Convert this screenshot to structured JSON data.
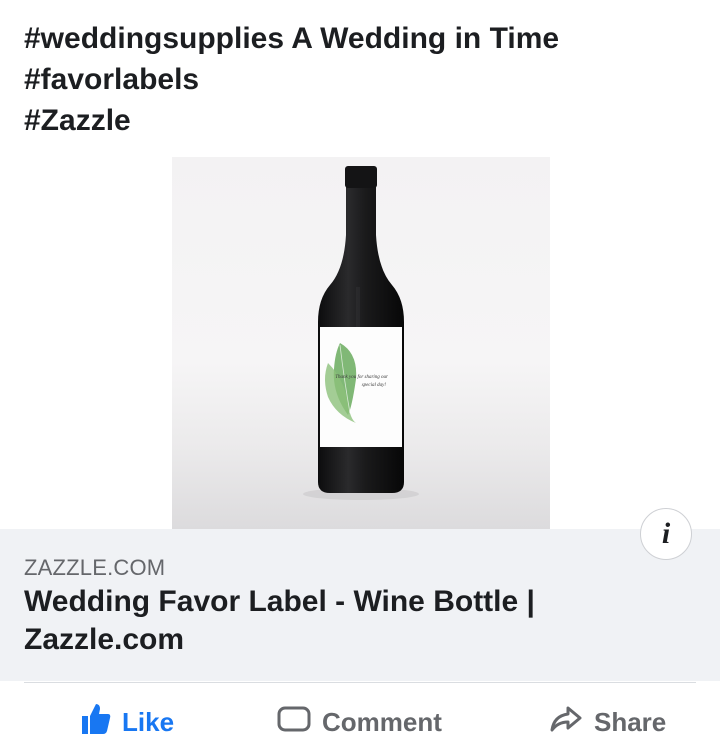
{
  "post": {
    "lines": [
      "#weddingsupplies A Wedding in Time",
      "#favorlabels",
      "#Zazzle"
    ]
  },
  "product_image": {
    "label_text": [
      "Thank you for sharing our",
      "special day!"
    ]
  },
  "link_preview": {
    "domain": "ZAZZLE.COM",
    "title": "Wedding Favor Label - Wine Bottle | Zazzle.com",
    "info_icon": "i"
  },
  "actions": [
    {
      "label": "Like",
      "icon": "thumbs-up-icon"
    },
    {
      "label": "Comment",
      "icon": "comment-icon"
    },
    {
      "label": "Share",
      "icon": "share-icon"
    }
  ]
}
